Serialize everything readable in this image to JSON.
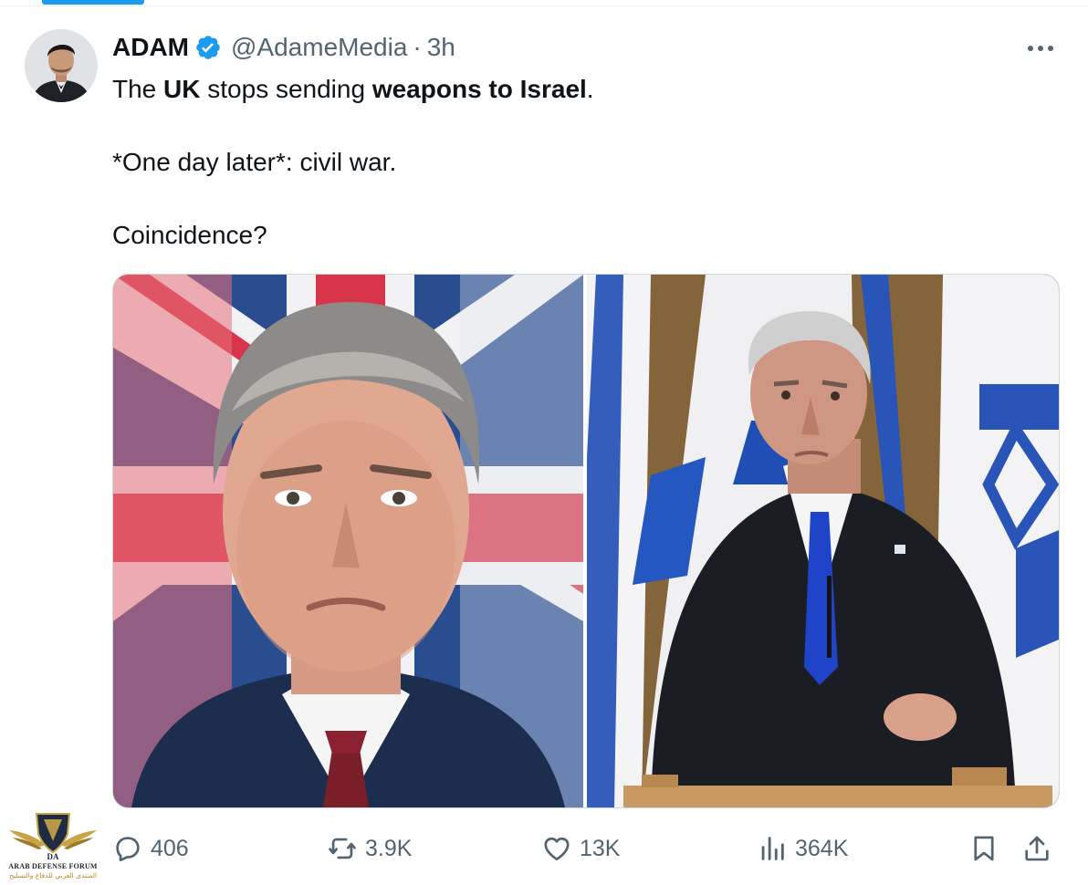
{
  "post": {
    "author": {
      "display_name": "ADAM",
      "handle": "@AdameMedia",
      "separator": "·",
      "time": "3h",
      "verified": true
    },
    "text": {
      "line1": {
        "p1": "The ",
        "b1": "UK",
        "p2": " stops sending ",
        "b2": "weapons to Israel",
        "p3": "."
      },
      "line2": "*One day later*: civil war.",
      "line3": "Coincidence?"
    },
    "media": [
      {
        "icon": "photo-man-union-jack-flag"
      },
      {
        "icon": "photo-man-podium-israeli-flags"
      }
    ],
    "actions": {
      "replies": "406",
      "reposts": "3.9K",
      "likes": "13K",
      "views": "364K"
    }
  },
  "watermark": {
    "english": "ARAB DEFENSE FORUM",
    "arabic": "المنتدى العربي للدفاع والتسليح",
    "monogram": "DA"
  },
  "colors": {
    "accent": "#1d9bf0",
    "muted_text": "#536471",
    "text": "#0f1419",
    "border": "#cfd9de"
  }
}
